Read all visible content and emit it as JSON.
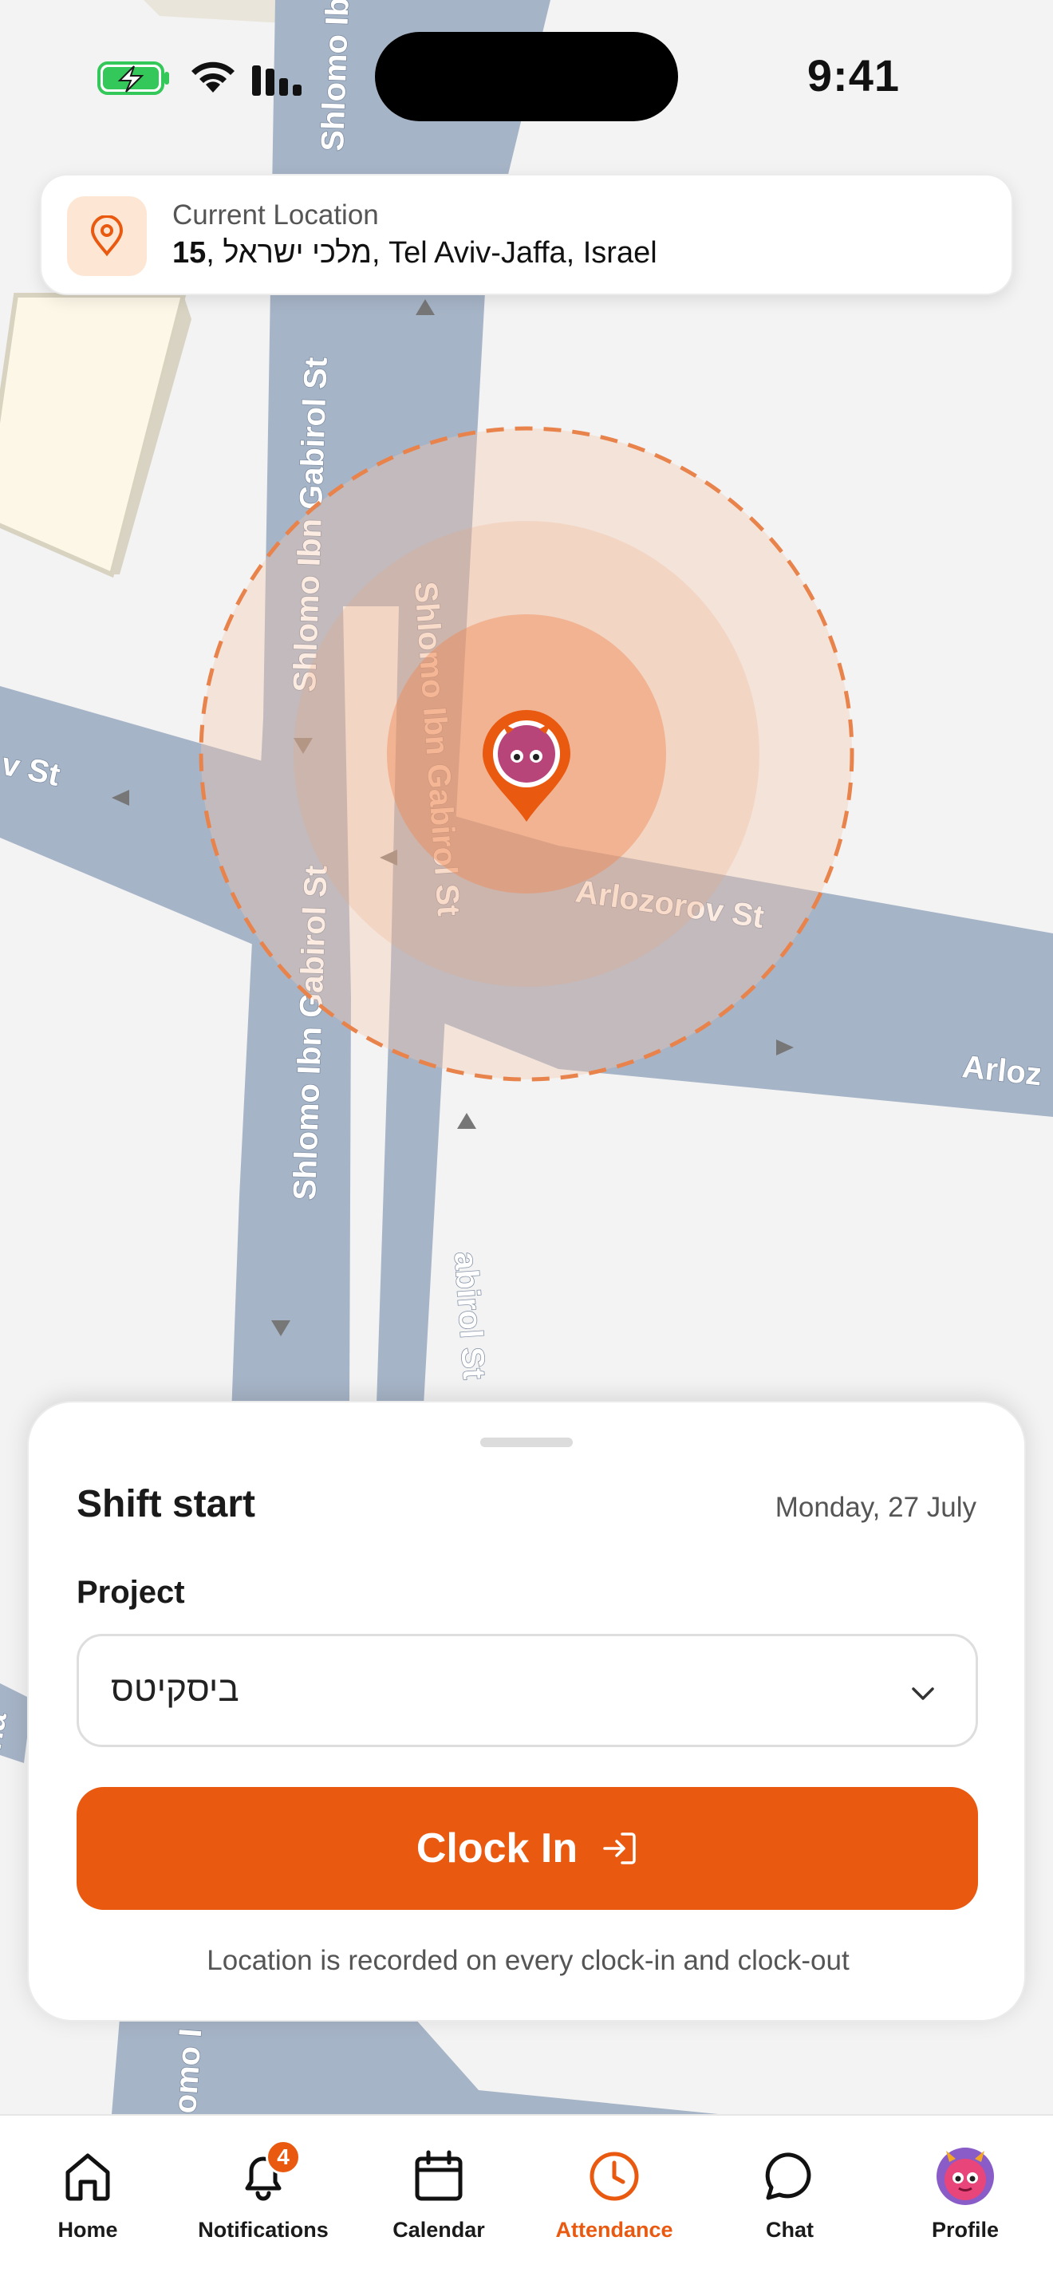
{
  "status_bar": {
    "time": "9:41"
  },
  "map": {
    "streets": {
      "s1": "Shlomo Ib",
      "s2": "Shlomo Ibn Gabirol St",
      "s3": "Shlomo Ibn Gabirol St",
      "s4": "Shlomo Ibn Gabirol St",
      "s5": "Shlomo Ibn Gabirol St",
      "s6": "abirol St",
      "s7": "Arlozorov St",
      "s8": "Arloz",
      "s9": "v St",
      "s10": "omo I",
      "s11": "ha"
    }
  },
  "location": {
    "label": "Current Location",
    "number": "15",
    "address": ", מלכי ישראל, Tel Aviv-Jaffa, Israel"
  },
  "sheet": {
    "title": "Shift start",
    "date": "Monday, 27 July",
    "project_label": "Project",
    "project_value": "ביסקיטס",
    "clockin_label": "Clock In",
    "footnote": "Location is recorded on every clock-in and clock-out"
  },
  "tabs": [
    {
      "label": "Home"
    },
    {
      "label": "Notifications",
      "badge": "4"
    },
    {
      "label": "Calendar"
    },
    {
      "label": "Attendance"
    },
    {
      "label": "Chat"
    },
    {
      "label": "Profile"
    }
  ],
  "colors": {
    "accent": "#e95a10",
    "road": "#a6b4c7",
    "radius_fill": "#f6c6a8"
  }
}
